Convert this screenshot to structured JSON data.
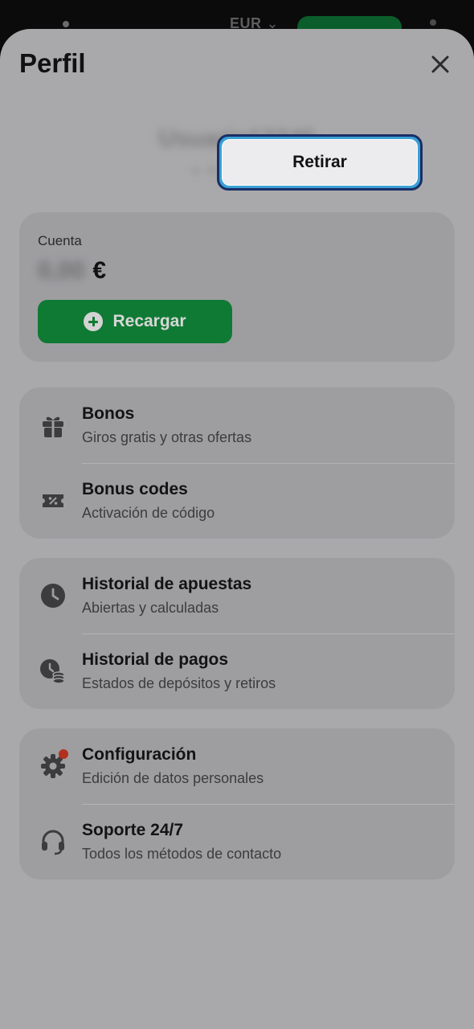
{
  "topbar": {
    "currency": "EUR"
  },
  "header": {
    "title": "Perfil"
  },
  "account": {
    "label": "Cuenta",
    "amount": "0,00",
    "currency_symbol": "€",
    "recargar_label": "Recargar",
    "retirar_label": "Retirar"
  },
  "user": {
    "username": "Usuario12345",
    "id": "ID 123456789"
  },
  "menu": {
    "bonos": {
      "title": "Bonos",
      "subtitle": "Giros gratis y otras ofertas"
    },
    "bonus_codes": {
      "title": "Bonus codes",
      "subtitle": "Activación de código"
    },
    "historial_apuestas": {
      "title": "Historial de apuestas",
      "subtitle": "Abiertas y calculadas"
    },
    "historial_pagos": {
      "title": "Historial de pagos",
      "subtitle": "Estados de depósitos y retiros"
    },
    "configuracion": {
      "title": "Configuración",
      "subtitle": "Edición de datos personales"
    },
    "soporte": {
      "title": "Soporte 24/7",
      "subtitle": "Todos los métodos de contacto"
    }
  },
  "colors": {
    "accent_green": "#0f7a33",
    "focus_ring": "#3aa0d6",
    "notification_dot": "#b3301e"
  }
}
